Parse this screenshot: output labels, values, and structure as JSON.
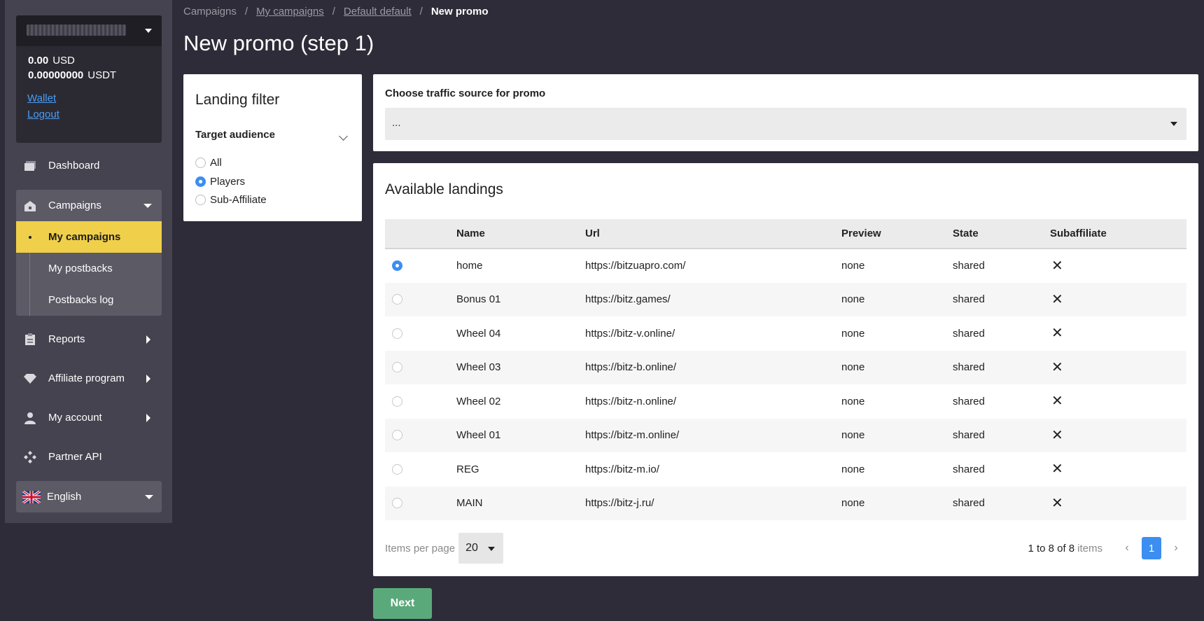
{
  "sidebar": {
    "balances": [
      {
        "amount": "0.00",
        "currency": "USD"
      },
      {
        "amount": "0.00000000",
        "currency": "USDT"
      }
    ],
    "wallet_label": "Wallet",
    "logout_label": "Logout",
    "nav": {
      "dashboard": "Dashboard",
      "campaigns": "Campaigns",
      "my_campaigns": "My campaigns",
      "my_postbacks": "My postbacks",
      "postbacks_log": "Postbacks log",
      "reports": "Reports",
      "affiliate_program": "Affiliate program",
      "my_account": "My account",
      "partner_api": "Partner API"
    },
    "language": "English"
  },
  "breadcrumb": {
    "campaigns": "Campaigns",
    "my_campaigns": "My campaigns",
    "default": "Default default",
    "current": "New promo",
    "sep": "/"
  },
  "page_title": "New promo (step 1)",
  "filter": {
    "title": "Landing filter",
    "target_audience_label": "Target audience",
    "options": [
      "All",
      "Players",
      "Sub-Affiliate"
    ],
    "selected": "Players"
  },
  "traffic": {
    "label": "Choose traffic source for promo",
    "value": "..."
  },
  "landings": {
    "title": "Available landings",
    "columns": [
      "Name",
      "Url",
      "Preview",
      "State",
      "Subaffiliate"
    ],
    "rows": [
      {
        "name": "home",
        "url": "https://bitzuapro.com/",
        "preview": "none",
        "state": "shared",
        "selected": true
      },
      {
        "name": "Bonus 01",
        "url": "https://bitz.games/",
        "preview": "none",
        "state": "shared",
        "selected": false
      },
      {
        "name": "Wheel 04",
        "url": "https://bitz-v.online/",
        "preview": "none",
        "state": "shared",
        "selected": false
      },
      {
        "name": "Wheel 03",
        "url": "https://bitz-b.online/",
        "preview": "none",
        "state": "shared",
        "selected": false
      },
      {
        "name": "Wheel 02",
        "url": "https://bitz-n.online/",
        "preview": "none",
        "state": "shared",
        "selected": false
      },
      {
        "name": "Wheel 01",
        "url": "https://bitz-m.online/",
        "preview": "none",
        "state": "shared",
        "selected": false
      },
      {
        "name": "REG",
        "url": "https://bitz-m.io/",
        "preview": "none",
        "state": "shared",
        "selected": false
      },
      {
        "name": "MAIN",
        "url": "https://bitz-j.ru/",
        "preview": "none",
        "state": "shared",
        "selected": false
      }
    ],
    "subaffiliate_mark": "✕",
    "pager": {
      "items_per_page_label": "Items per page",
      "items_per_page": "20",
      "range": "1 to 8 of 8",
      "items_word": "items",
      "current_page": "1",
      "prev": "‹",
      "next": "›"
    }
  },
  "next_button": "Next",
  "colors": {
    "background": "#2d2c38",
    "sidebar": "#44434f",
    "active_nav": "#f0cf4a",
    "accent": "#3c8ef0",
    "next_button": "#5aa97a",
    "link": "#4a9cf2"
  }
}
